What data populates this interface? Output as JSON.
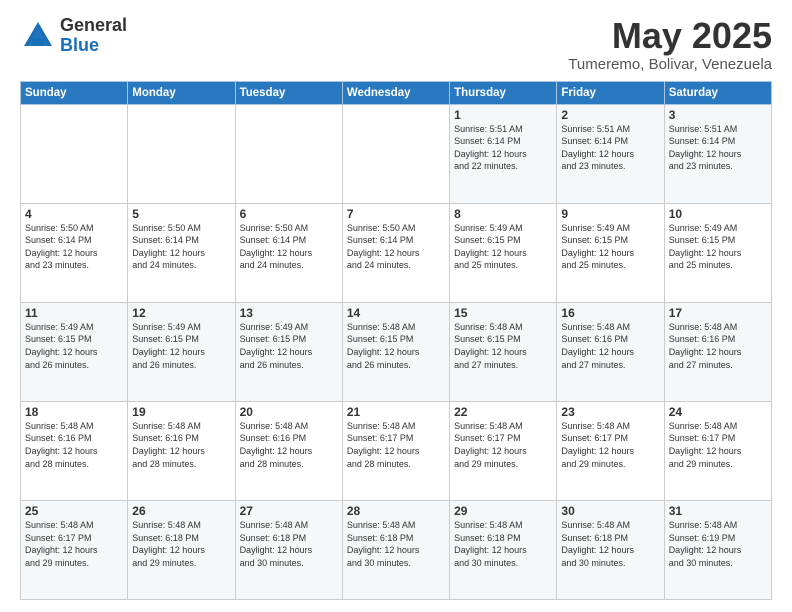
{
  "logo": {
    "general": "General",
    "blue": "Blue"
  },
  "title": "May 2025",
  "subtitle": "Tumeremo, Bolivar, Venezuela",
  "days_of_week": [
    "Sunday",
    "Monday",
    "Tuesday",
    "Wednesday",
    "Thursday",
    "Friday",
    "Saturday"
  ],
  "weeks": [
    [
      {
        "day": "",
        "info": ""
      },
      {
        "day": "",
        "info": ""
      },
      {
        "day": "",
        "info": ""
      },
      {
        "day": "",
        "info": ""
      },
      {
        "day": "1",
        "info": "Sunrise: 5:51 AM\nSunset: 6:14 PM\nDaylight: 12 hours\nand 22 minutes."
      },
      {
        "day": "2",
        "info": "Sunrise: 5:51 AM\nSunset: 6:14 PM\nDaylight: 12 hours\nand 23 minutes."
      },
      {
        "day": "3",
        "info": "Sunrise: 5:51 AM\nSunset: 6:14 PM\nDaylight: 12 hours\nand 23 minutes."
      }
    ],
    [
      {
        "day": "4",
        "info": "Sunrise: 5:50 AM\nSunset: 6:14 PM\nDaylight: 12 hours\nand 23 minutes."
      },
      {
        "day": "5",
        "info": "Sunrise: 5:50 AM\nSunset: 6:14 PM\nDaylight: 12 hours\nand 24 minutes."
      },
      {
        "day": "6",
        "info": "Sunrise: 5:50 AM\nSunset: 6:14 PM\nDaylight: 12 hours\nand 24 minutes."
      },
      {
        "day": "7",
        "info": "Sunrise: 5:50 AM\nSunset: 6:14 PM\nDaylight: 12 hours\nand 24 minutes."
      },
      {
        "day": "8",
        "info": "Sunrise: 5:49 AM\nSunset: 6:15 PM\nDaylight: 12 hours\nand 25 minutes."
      },
      {
        "day": "9",
        "info": "Sunrise: 5:49 AM\nSunset: 6:15 PM\nDaylight: 12 hours\nand 25 minutes."
      },
      {
        "day": "10",
        "info": "Sunrise: 5:49 AM\nSunset: 6:15 PM\nDaylight: 12 hours\nand 25 minutes."
      }
    ],
    [
      {
        "day": "11",
        "info": "Sunrise: 5:49 AM\nSunset: 6:15 PM\nDaylight: 12 hours\nand 26 minutes."
      },
      {
        "day": "12",
        "info": "Sunrise: 5:49 AM\nSunset: 6:15 PM\nDaylight: 12 hours\nand 26 minutes."
      },
      {
        "day": "13",
        "info": "Sunrise: 5:49 AM\nSunset: 6:15 PM\nDaylight: 12 hours\nand 26 minutes."
      },
      {
        "day": "14",
        "info": "Sunrise: 5:48 AM\nSunset: 6:15 PM\nDaylight: 12 hours\nand 26 minutes."
      },
      {
        "day": "15",
        "info": "Sunrise: 5:48 AM\nSunset: 6:15 PM\nDaylight: 12 hours\nand 27 minutes."
      },
      {
        "day": "16",
        "info": "Sunrise: 5:48 AM\nSunset: 6:16 PM\nDaylight: 12 hours\nand 27 minutes."
      },
      {
        "day": "17",
        "info": "Sunrise: 5:48 AM\nSunset: 6:16 PM\nDaylight: 12 hours\nand 27 minutes."
      }
    ],
    [
      {
        "day": "18",
        "info": "Sunrise: 5:48 AM\nSunset: 6:16 PM\nDaylight: 12 hours\nand 28 minutes."
      },
      {
        "day": "19",
        "info": "Sunrise: 5:48 AM\nSunset: 6:16 PM\nDaylight: 12 hours\nand 28 minutes."
      },
      {
        "day": "20",
        "info": "Sunrise: 5:48 AM\nSunset: 6:16 PM\nDaylight: 12 hours\nand 28 minutes."
      },
      {
        "day": "21",
        "info": "Sunrise: 5:48 AM\nSunset: 6:17 PM\nDaylight: 12 hours\nand 28 minutes."
      },
      {
        "day": "22",
        "info": "Sunrise: 5:48 AM\nSunset: 6:17 PM\nDaylight: 12 hours\nand 29 minutes."
      },
      {
        "day": "23",
        "info": "Sunrise: 5:48 AM\nSunset: 6:17 PM\nDaylight: 12 hours\nand 29 minutes."
      },
      {
        "day": "24",
        "info": "Sunrise: 5:48 AM\nSunset: 6:17 PM\nDaylight: 12 hours\nand 29 minutes."
      }
    ],
    [
      {
        "day": "25",
        "info": "Sunrise: 5:48 AM\nSunset: 6:17 PM\nDaylight: 12 hours\nand 29 minutes."
      },
      {
        "day": "26",
        "info": "Sunrise: 5:48 AM\nSunset: 6:18 PM\nDaylight: 12 hours\nand 29 minutes."
      },
      {
        "day": "27",
        "info": "Sunrise: 5:48 AM\nSunset: 6:18 PM\nDaylight: 12 hours\nand 30 minutes."
      },
      {
        "day": "28",
        "info": "Sunrise: 5:48 AM\nSunset: 6:18 PM\nDaylight: 12 hours\nand 30 minutes."
      },
      {
        "day": "29",
        "info": "Sunrise: 5:48 AM\nSunset: 6:18 PM\nDaylight: 12 hours\nand 30 minutes."
      },
      {
        "day": "30",
        "info": "Sunrise: 5:48 AM\nSunset: 6:18 PM\nDaylight: 12 hours\nand 30 minutes."
      },
      {
        "day": "31",
        "info": "Sunrise: 5:48 AM\nSunset: 6:19 PM\nDaylight: 12 hours\nand 30 minutes."
      }
    ]
  ]
}
